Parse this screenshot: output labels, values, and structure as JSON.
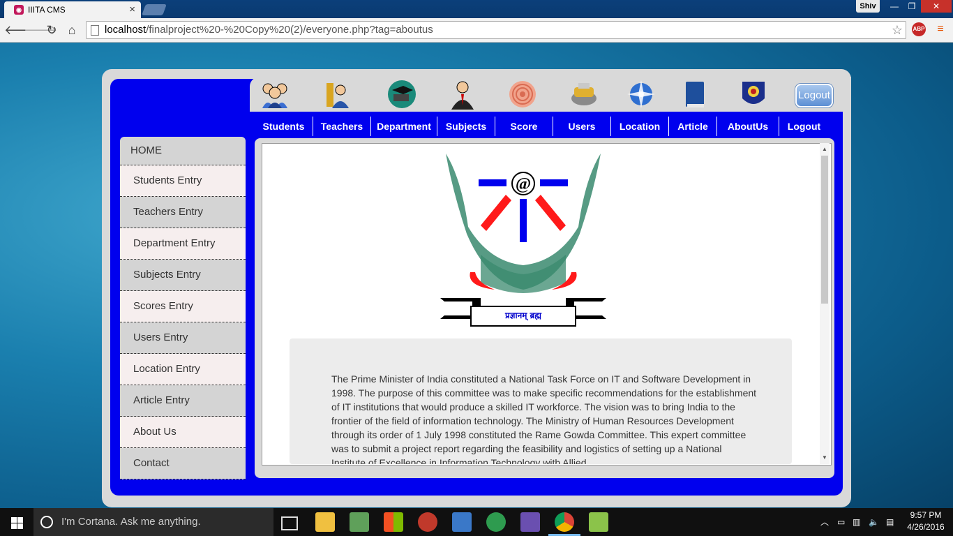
{
  "browser": {
    "tab_title": "IIITA CMS",
    "tab_close": "×",
    "user_badge": "Shiv",
    "url_host": "localhost",
    "url_path": "/finalproject%20-%20Copy%20(2)/everyone.php?tag=aboutus",
    "abp_label": "ABP",
    "window_buttons": [
      "—",
      "❐",
      "✕"
    ]
  },
  "icons": {
    "students": "students-icon",
    "teachers": "teachers-icon",
    "department": "department-icon",
    "subjects": "subjects-icon",
    "score": "score-icon",
    "users": "users-icon",
    "location": "location-globe-icon",
    "article": "book-icon",
    "aboutus": "emblem-icon",
    "logout_label": "Logout"
  },
  "topnav": [
    {
      "label": "Students"
    },
    {
      "label": "Teachers"
    },
    {
      "label": "Department"
    },
    {
      "label": "Subjects"
    },
    {
      "label": "Score"
    },
    {
      "label": "Users"
    },
    {
      "label": "Location"
    },
    {
      "label": "Article"
    },
    {
      "label": "AboutUs"
    },
    {
      "label": "Logout"
    }
  ],
  "sidebar": [
    {
      "label": "HOME"
    },
    {
      "label": "Students Entry"
    },
    {
      "label": "Teachers Entry"
    },
    {
      "label": "Department Entry"
    },
    {
      "label": "Subjects Entry"
    },
    {
      "label": "Scores Entry"
    },
    {
      "label": "Users Entry"
    },
    {
      "label": "Location Entry"
    },
    {
      "label": "Article Entry"
    },
    {
      "label": "About Us"
    },
    {
      "label": "Contact"
    }
  ],
  "content": {
    "logo_motto": "प्रज्ञानम् ब्रह्म",
    "about_text": "The Prime Minister of India constituted a National Task Force on IT and Software Development in 1998. The purpose of this committee was to make specific recommendations for the establishment of IT institutions that would produce a skilled IT workforce. The vision was to bring India to the frontier of the field of information technology. The Ministry of Human Resources Development through its order of 1 July 1998 constituted the Rame Gowda Committee. This expert committee was to submit a project report regarding the feasibility and logistics of setting up a National Institute of Excellence in Information Technology with Allied"
  },
  "taskbar": {
    "search_placeholder": "I'm Cortana. Ask me anything.",
    "time": "9:57 PM",
    "date": "4/26/2016"
  },
  "colors": {
    "page_blue": "#0000ee",
    "frame_gray": "#d9d9d9",
    "logo_red": "#ff1a1a",
    "logo_blue": "#0000ee",
    "logo_green": "#3a8a6e"
  }
}
